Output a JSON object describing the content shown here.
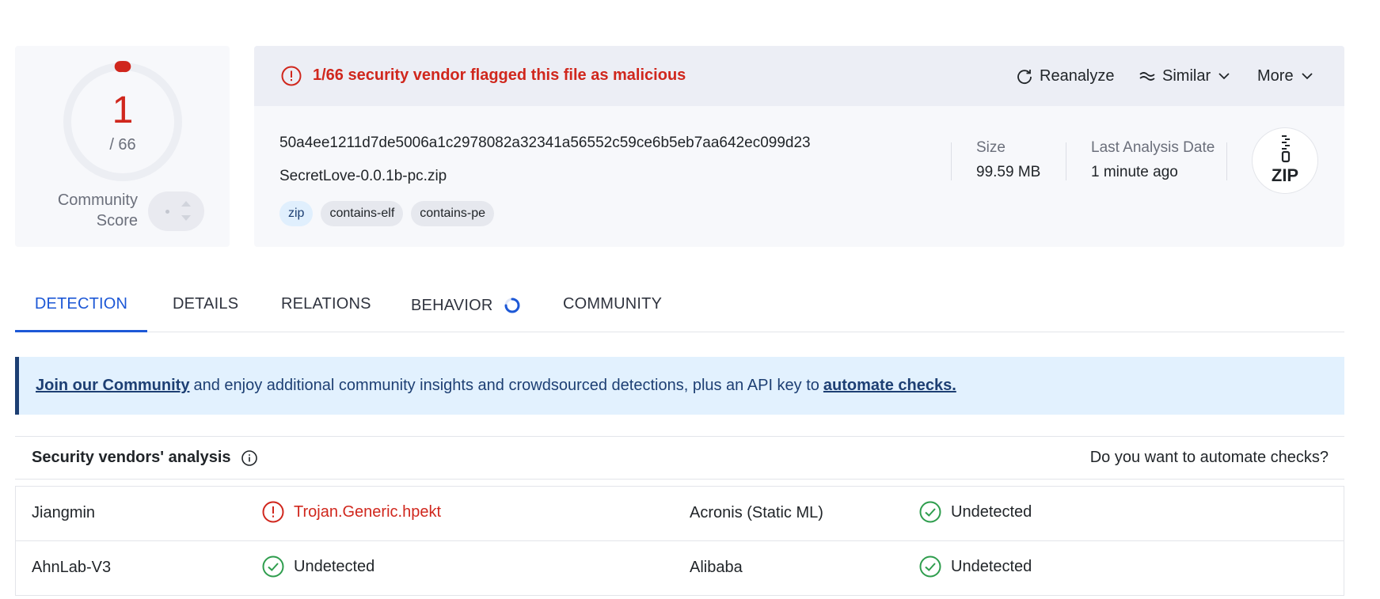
{
  "score": {
    "value": "1",
    "total": "/ 66",
    "detected_fraction": 0.015,
    "community_label_line1": "Community",
    "community_label_line2": "Score"
  },
  "alert": {
    "text": "1/66 security vendor flagged this file as malicious"
  },
  "actions": {
    "reanalyze": "Reanalyze",
    "similar": "Similar",
    "more": "More"
  },
  "file": {
    "hash": "50a4ee1211d7de5006a1c2978082a32341a56552c59ce6b5eb7aa642ec099d23",
    "name": "SecretLove-0.0.1b-pc.zip",
    "tags": [
      "zip",
      "contains-elf",
      "contains-pe"
    ],
    "size_label": "Size",
    "size_value": "99.59 MB",
    "date_label": "Last Analysis Date",
    "date_value": "1 minute ago",
    "type_badge": "ZIP"
  },
  "tabs": [
    {
      "label": "DETECTION",
      "active": true
    },
    {
      "label": "DETAILS"
    },
    {
      "label": "RELATIONS"
    },
    {
      "label": "BEHAVIOR"
    },
    {
      "label": "COMMUNITY"
    }
  ],
  "banner": {
    "join_link": "Join our Community",
    "middle_text": "and enjoy additional community insights and crowdsourced detections, plus an API key to",
    "automate_link": "automate checks."
  },
  "vendors": {
    "title": "Security vendors' analysis",
    "automate_prompt": "Do you want to automate checks?",
    "rows": [
      [
        {
          "vendor": "Jiangmin",
          "result": "Trojan.Generic.hpekt",
          "status": "malicious"
        },
        {
          "vendor": "Acronis (Static ML)",
          "result": "Undetected",
          "status": "clean"
        }
      ],
      [
        {
          "vendor": "AhnLab-V3",
          "result": "Undetected",
          "status": "clean"
        },
        {
          "vendor": "Alibaba",
          "result": "Undetected",
          "status": "clean"
        }
      ]
    ]
  },
  "colors": {
    "malicious": "#d0271d",
    "clean": "#2e9d4d",
    "accent": "#1d58d6",
    "banner_text": "#1d3f73"
  }
}
